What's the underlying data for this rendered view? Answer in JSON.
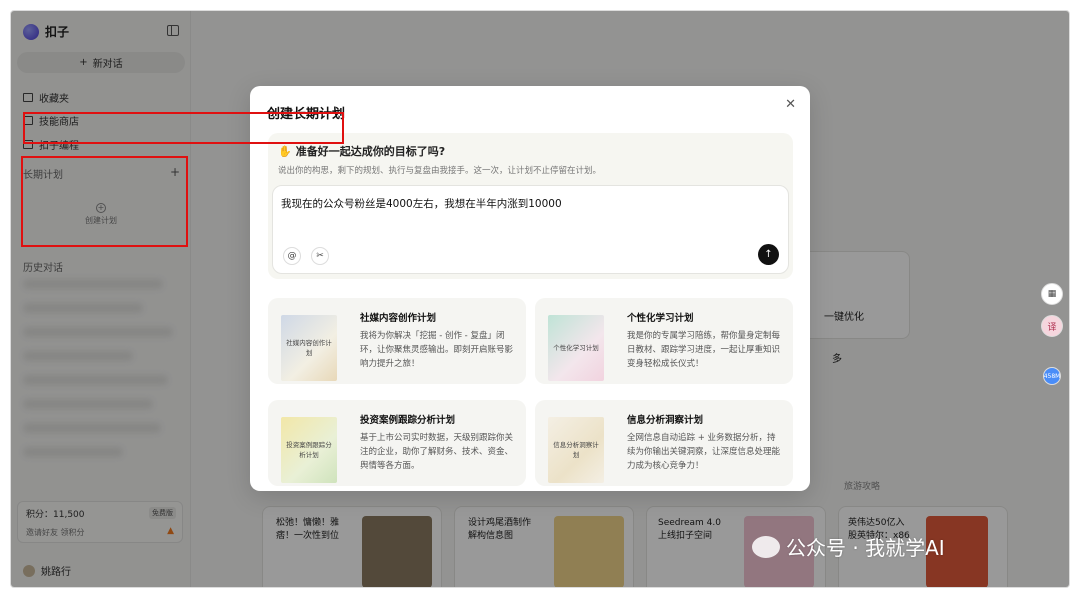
{
  "app": {
    "name": "扣子"
  },
  "sidebar": {
    "new_chat": "新对话",
    "nav": [
      {
        "label": "收藏夹",
        "icon": "folder-icon"
      },
      {
        "label": "技能商店",
        "icon": "store-icon"
      },
      {
        "label": "扣子编程",
        "icon": "code-icon"
      }
    ],
    "long_term_plans": {
      "label": "长期计划",
      "create_label": "创建计划"
    },
    "history_label": "历史对话",
    "points": {
      "label": "积分：11,500",
      "badge": "免费版",
      "invite": "邀请好友 领积分"
    },
    "user": {
      "name": "姚路行"
    }
  },
  "background": {
    "optimize_label": "一键优化",
    "more_label": "多",
    "travel_label": "旅游攻略",
    "cards": [
      {
        "text": "松弛！慵懒！雅痞！一次性到位"
      },
      {
        "text": "设计鸡尾酒制作解构信息图"
      },
      {
        "text": "Seedream 4.0 上线扣子空间"
      },
      {
        "text": "英伟达50亿入股英特尔：x86"
      }
    ],
    "badge_count": "458M",
    "translate_icon_label": "译"
  },
  "modal": {
    "title": "创建长期计划",
    "prompt_title": "准备好一起达成你的目标了吗?",
    "prompt_sub": "说出你的构思，剩下的规划、执行与复盘由我接手。这一次，让计划不止停留在计划。",
    "input_value": "我现在的公众号粉丝是4000左右，我想在半年内涨到10000",
    "templates": [
      {
        "title": "社媒内容创作计划",
        "desc": "我将为你解决「挖掘 - 创作 - 复盘」闭环，让你聚焦灵感输出。即刻开启账号影响力提升之旅！",
        "cover": "社媒内容创作计划"
      },
      {
        "title": "个性化学习计划",
        "desc": "我是你的专属学习陪练，帮你量身定制每日教材、跟踪学习进度，一起让厚重知识变身轻松成长仪式！",
        "cover": "个性化学习计划"
      },
      {
        "title": "投资案例跟踪分析计划",
        "desc": "基于上市公司实时数据，天级别跟踪你关注的企业，助你了解财务、技术、资金、舆情等各方面。",
        "cover": "投资案例跟踪分析计划"
      },
      {
        "title": "信息分析洞察计划",
        "desc": "全网信息自动追踪 + 业务数据分析，持续为你输出关键洞察，让深度信息处理能力成为核心竞争力！",
        "cover": "信息分析洞察计划"
      }
    ]
  },
  "watermark": "公众号 · 我就学AI",
  "colors": {
    "highlight_red": "#e01010",
    "send_button": "#111111"
  }
}
